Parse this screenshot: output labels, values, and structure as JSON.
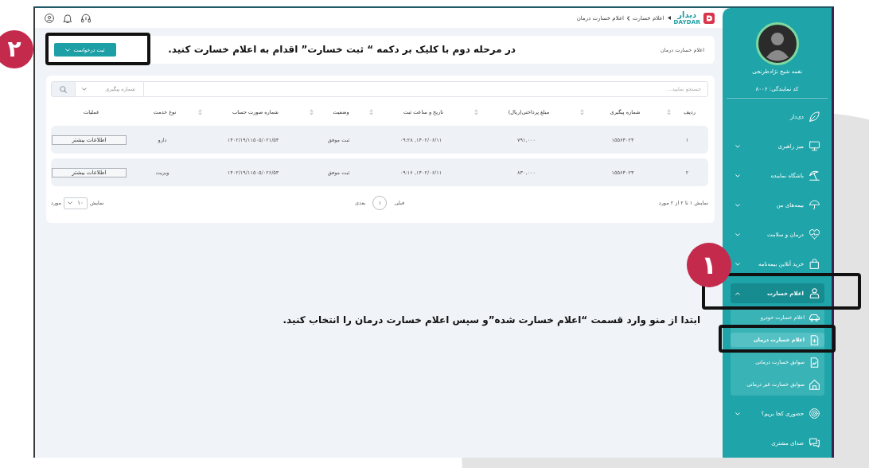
{
  "topbar": {
    "logo": {
      "name": "دیدار",
      "latin": "DAYDAR"
    },
    "breadcrumb": [
      "اعلام خسارت",
      "اعلام خسارت درمان"
    ]
  },
  "header": {
    "title": "اعلام خسارت درمان",
    "button": "ثبت درخواست"
  },
  "table": {
    "search": {
      "placeholder": "جستجو نمایید...",
      "filter": "شماره پیگیری"
    },
    "columns": [
      {
        "label": "ردیف",
        "sortable": true
      },
      {
        "label": "شماره پیگیری",
        "sortable": true
      },
      {
        "label": "مبلغ پرداختی(ریال)",
        "sortable": true
      },
      {
        "label": "تاریخ و ساعت ثبت",
        "sortable": true
      },
      {
        "label": "وضعیت",
        "sortable": true
      },
      {
        "label": "شماره صورت حساب",
        "sortable": true
      },
      {
        "label": "نوع خدمت",
        "sortable": false
      },
      {
        "label": "عملیات",
        "sortable": false
      }
    ],
    "rows": [
      {
        "cells": [
          "۱",
          "۱۵۵۶۴۰۲۴",
          "۷۹۱,۰۰۰",
          "۱۴۰۲/۰۶/۱۱, ۰۹:۲۸",
          "ثبت موفق",
          "۱۴۰۲/۱۹/۱۱۵۰۵/۰۲۱/۵۴",
          "دارو"
        ],
        "action": "اطلاعات بیشتر"
      },
      {
        "cells": [
          "۲",
          "۱۵۵۶۴۰۲۳",
          "۸۳۰,۰۰۰",
          "۱۴۰۲/۰۶/۱۱, ۰۹:۱۶",
          "ثبت موفق",
          "۱۴۰۲/۱۹/۱۱۵۰۵/۰۲۶/۵۳",
          "ویزیت"
        ],
        "action": "اطلاعات بیشتر"
      }
    ],
    "footer": {
      "summary": "نمایش ۱ تا ۲ از ۲ مورد",
      "previous": "قبلی",
      "page": "۱",
      "next": "بعدی",
      "page_size_prefix": "نمایش",
      "page_size": "۱۰",
      "page_size_suffix": "مورد"
    }
  },
  "sidebar": {
    "profile": {
      "name": "نغمه شیخ نژادطرنجی",
      "code": "کد نمایندگی: ۸۰۰۶"
    },
    "items": [
      {
        "label": "دی‌دار",
        "kind": "link",
        "selected": false
      },
      {
        "label": "میز راهبری",
        "kind": "menu",
        "selected": false,
        "expanded": false
      },
      {
        "label": "باشگاه نماینده",
        "kind": "menu",
        "selected": false,
        "expanded": false
      },
      {
        "label": "بیمه‌های من",
        "kind": "menu",
        "selected": false,
        "expanded": false
      },
      {
        "label": "درمان و سلامت",
        "kind": "menu",
        "selected": false,
        "expanded": false
      },
      {
        "label": "خرید آنلاین بیمه‌نامه",
        "kind": "menu",
        "selected": false,
        "expanded": false
      },
      {
        "label": "اعلام خسارت",
        "kind": "menu",
        "selected": true,
        "expanded": true,
        "children": [
          {
            "label": "اعلام خسارت خودرو",
            "selected": false
          },
          {
            "label": "اعلام خسارت درمان",
            "selected": true
          },
          {
            "label": "سوابق خسارت درمانی",
            "selected": false
          },
          {
            "label": "سوابق خسارت غیر درمانی",
            "selected": false
          }
        ]
      },
      {
        "label": "حضوری کجا بریم؟",
        "kind": "menu",
        "selected": false,
        "expanded": false
      },
      {
        "label": "صدای مشتری",
        "kind": "link",
        "selected": false
      }
    ]
  },
  "annotations": [
    {
      "badge": "۲",
      "note": "در مرحله دوم با کلیک بر دکمه “ ثبت خسارت” اقدام به اعلام خسارت کنید."
    },
    {
      "badge": "۱",
      "note": "ابتدا از منو وارد قسمت “اعلام خسارت شده”و سپس اعلام خسارت درمان را انتخاب کنید."
    }
  ]
}
